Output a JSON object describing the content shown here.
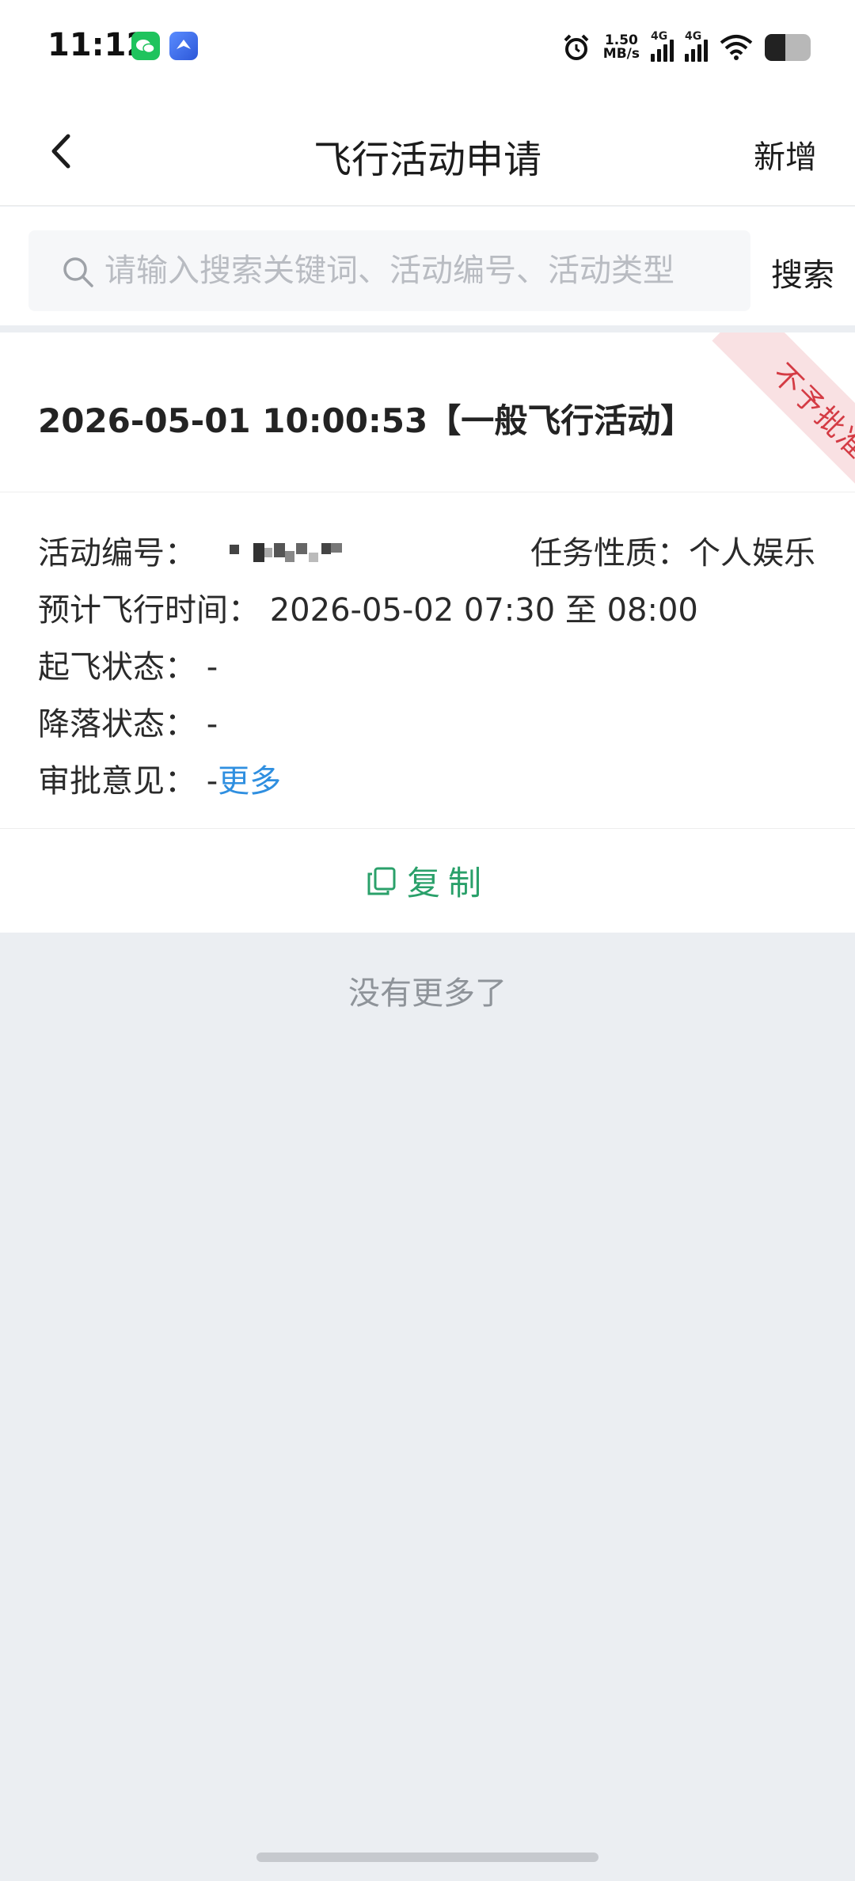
{
  "status_bar": {
    "time": "11:12",
    "net_speed_value": "1.50",
    "net_speed_unit": "MB/s",
    "signal1_label": "4G",
    "signal2_label": "4G",
    "battery_level": 0.45,
    "icons": [
      "wechat-icon",
      "app-icon",
      "alarm-icon",
      "signal-icon",
      "wifi-icon",
      "battery-icon"
    ]
  },
  "nav": {
    "title": "飞行活动申请",
    "add_label": "新增"
  },
  "search": {
    "placeholder": "请输入搜索关键词、活动编号、活动类型",
    "button_label": "搜索"
  },
  "card": {
    "title": "2026-05-01 10:00:53【一般飞行活动】",
    "stamp": "不予批准",
    "stamp_color": "#d43b44",
    "fields": {
      "activity_id_label": "活动编号：",
      "task_nature_label": "任务性质：",
      "task_nature_value": "个人娱乐",
      "planned_time_label": "预计飞行时间：",
      "planned_time_value": "2026-05-02 07:30 至 08:00",
      "takeoff_label": "起飞状态：",
      "takeoff_value": "-",
      "landing_label": "降落状态：",
      "landing_value": "-",
      "opinion_label": "审批意见：",
      "opinion_value": "-",
      "more_link": "更多"
    },
    "copy_label": "复制"
  },
  "list_footer": "没有更多了",
  "colors": {
    "accent_green": "#2aa06a",
    "link_blue": "#2f8fe0",
    "background": "#ebeef2"
  }
}
